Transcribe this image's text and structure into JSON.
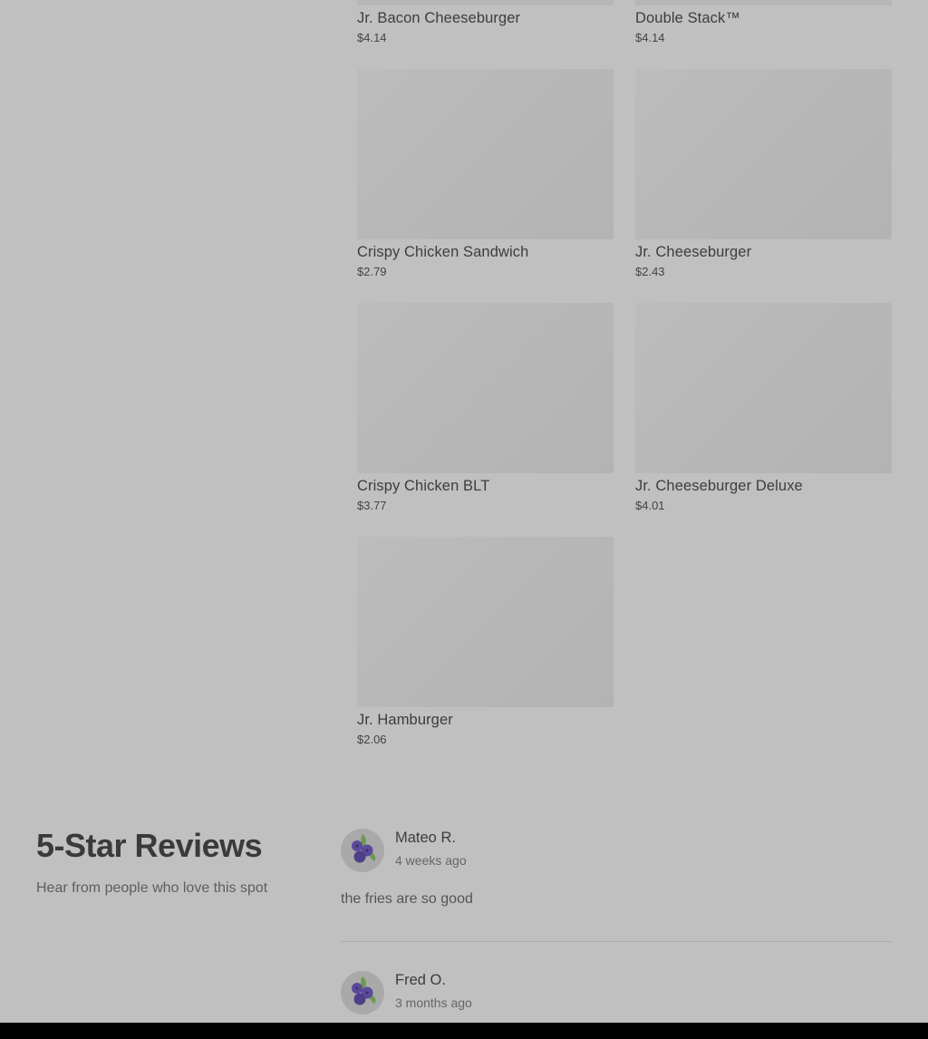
{
  "menu": {
    "items": [
      {
        "name": "Jr. Bacon Cheeseburger",
        "price": "$4.14"
      },
      {
        "name": "Double Stack™",
        "price": "$4.14"
      },
      {
        "name": "Crispy Chicken Sandwich",
        "price": "$2.79"
      },
      {
        "name": "Jr. Cheeseburger",
        "price": "$2.43"
      },
      {
        "name": "Crispy Chicken BLT",
        "price": "$3.77"
      },
      {
        "name": "Jr. Cheeseburger Deluxe",
        "price": "$4.01"
      },
      {
        "name": "Jr. Hamburger",
        "price": "$2.06"
      }
    ]
  },
  "reviews_section": {
    "heading": "5-Star Reviews",
    "subheading": "Hear from people who love this spot",
    "reviews": [
      {
        "name": "Mateo R.",
        "time": "4 weeks ago",
        "text": "the fries are so good",
        "avatar_icon": "blueberry-icon"
      },
      {
        "name": "Fred O.",
        "time": "3 months ago",
        "text": "",
        "avatar_icon": "blueberry-icon"
      }
    ]
  },
  "colors": {
    "background": "#c0c0c0",
    "image_placeholder": "#b8b8b8",
    "avatar_berry": "#5b4a9a",
    "avatar_leaf": "#6b9a4e"
  }
}
